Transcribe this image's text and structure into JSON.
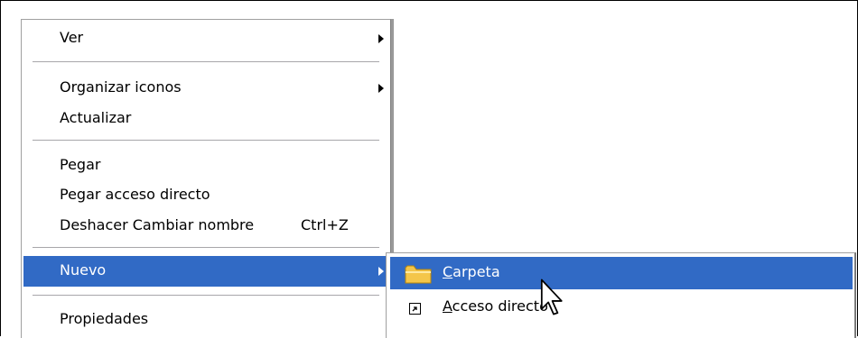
{
  "context_menu": {
    "items": [
      {
        "label": "Ver",
        "has_submenu": true
      },
      {
        "label": "Organizar iconos",
        "has_submenu": true
      },
      {
        "label": "Actualizar"
      },
      {
        "label": "Pegar"
      },
      {
        "label": "Pegar acceso directo"
      },
      {
        "label": "Deshacer Cambiar nombre",
        "shortcut": "Ctrl+Z"
      },
      {
        "label": "Nuevo",
        "has_submenu": true,
        "selected": true
      },
      {
        "label": "Propiedades"
      }
    ]
  },
  "submenu_nuevo": {
    "items": [
      {
        "mnemonic": "C",
        "rest": "arpeta",
        "icon": "folder-icon",
        "selected": true
      },
      {
        "mnemonic": "A",
        "rest": "cceso directo",
        "icon": "shortcut-icon"
      }
    ]
  },
  "colors": {
    "selection": "#316ac5",
    "separator": "#a7a6aa",
    "folder": "#f4c64a"
  }
}
